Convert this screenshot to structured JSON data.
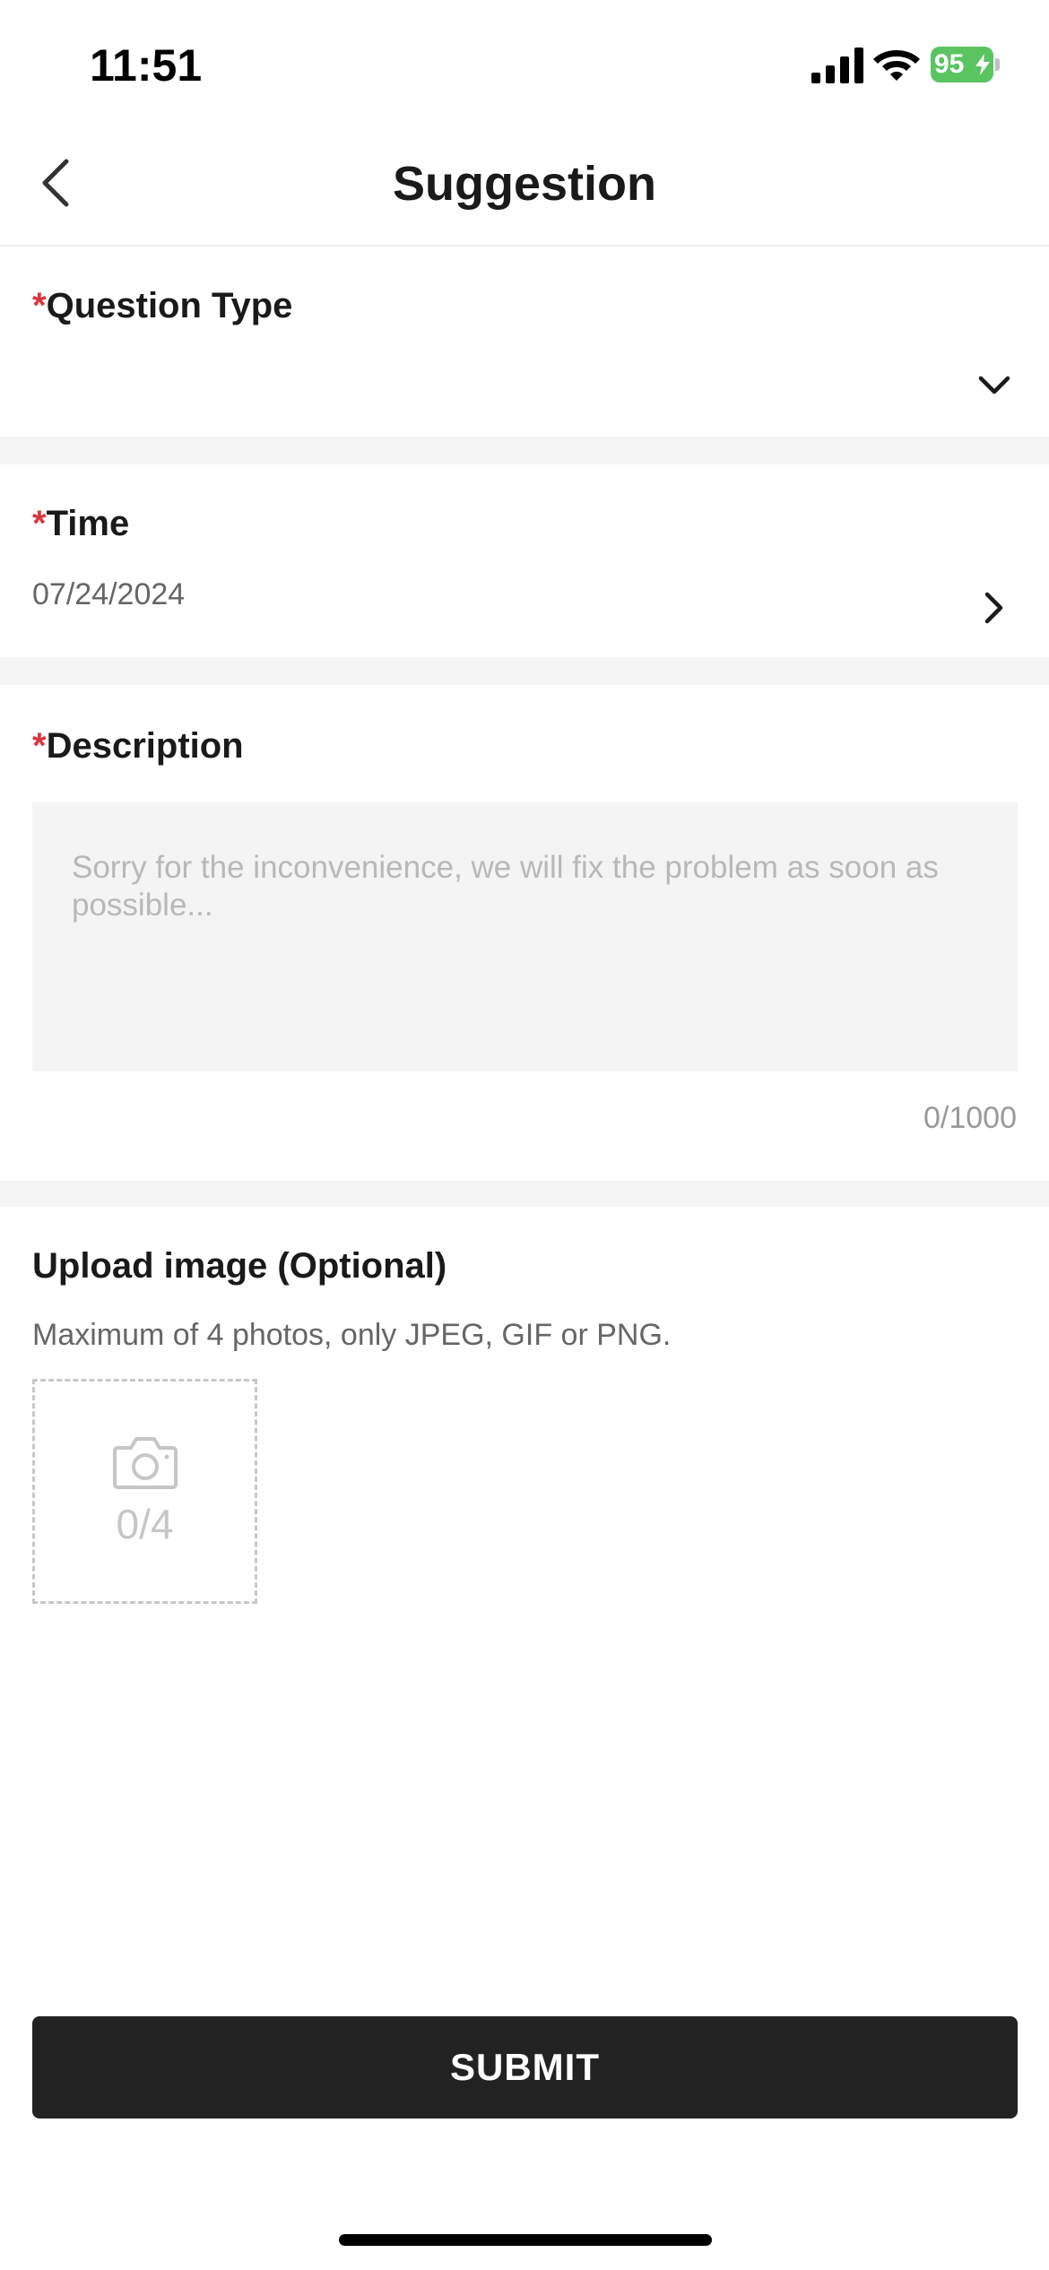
{
  "status_bar": {
    "time": "11:51",
    "battery": "95",
    "battery_color": "#5ac461"
  },
  "nav": {
    "title": "Suggestion",
    "back_icon": "chevron-left-icon"
  },
  "form": {
    "required_marker": "*",
    "question_type": {
      "label": "Question Type",
      "value": "",
      "icon": "chevron-down-icon"
    },
    "time": {
      "label": "Time",
      "value": "07/24/2024",
      "icon": "chevron-right-icon"
    },
    "description": {
      "label": "Description",
      "value": "",
      "placeholder": "Sorry for the inconvenience, we will fix the problem as soon as possible...",
      "counter": "0/1000"
    },
    "upload": {
      "title": "Upload image (Optional)",
      "subtitle": "Maximum of 4 photos, only JPEG, GIF or PNG.",
      "count": "0/4",
      "icon": "camera-icon"
    },
    "submit_label": "SUBMIT"
  },
  "colors": {
    "required": "#d9363e",
    "button_bg": "#222222",
    "divider": "#f5f5f5"
  }
}
